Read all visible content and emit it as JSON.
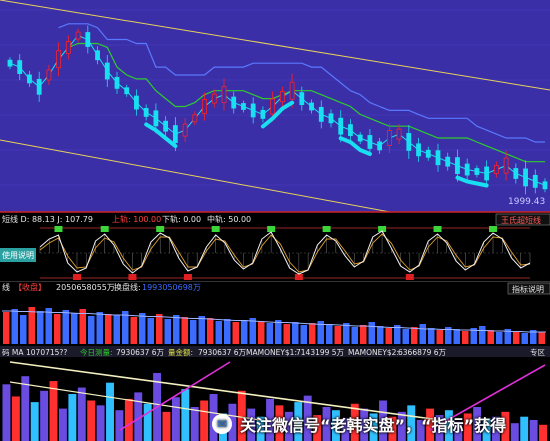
{
  "colors": {
    "panel1_bg": "#3b2fa8",
    "panel_bg": "#000000",
    "channel": "#e8d25a",
    "cyan": "#19e0f0",
    "red_candle": "#ff2020",
    "green_line": "#2dcc2d",
    "blue_line": "#5a78ff",
    "magenta": "#e030d8",
    "volume_blue": "#3b6cff",
    "white_line": "#f2f2f2"
  },
  "panel1": {
    "price_label": "1999.43",
    "chart_data": {
      "type": "line",
      "x": [
        0,
        1,
        2,
        3,
        4,
        5,
        6,
        7,
        8,
        9,
        10,
        11,
        12,
        13,
        14,
        15,
        16,
        17,
        18,
        19,
        20,
        21,
        22,
        23,
        24,
        25,
        26,
        27,
        28,
        29,
        30,
        31,
        32,
        33,
        34,
        35,
        36,
        37,
        38,
        39,
        40,
        41,
        42,
        43,
        44,
        45,
        46,
        47,
        48,
        49,
        50,
        51,
        52,
        53,
        54,
        55
      ],
      "series": [
        {
          "color": "cyan-red",
          "values": [
            72,
            70,
            64,
            60,
            66,
            74,
            80,
            86,
            84,
            76,
            68,
            62,
            58,
            52,
            47,
            44,
            40,
            36,
            38,
            44,
            50,
            54,
            56,
            52,
            50,
            48,
            46,
            50,
            55,
            58,
            54,
            50,
            46,
            44,
            40,
            38,
            34,
            32,
            30,
            34,
            36,
            32,
            28,
            26,
            24,
            22,
            20,
            18,
            17,
            16,
            18,
            20,
            16,
            14,
            12,
            10
          ]
        },
        {
          "color": "green",
          "values": [
            null,
            null,
            null,
            null,
            null,
            null,
            80,
            82,
            82,
            82,
            80,
            70,
            66,
            64,
            64,
            58,
            54,
            50,
            50,
            52,
            56,
            58,
            58,
            58,
            58,
            56,
            54,
            54,
            56,
            58,
            58,
            58,
            56,
            54,
            52,
            50,
            46,
            44,
            42,
            40,
            40,
            40,
            38,
            36,
            34,
            34,
            34,
            34,
            32,
            30,
            28,
            26,
            24,
            22,
            22,
            22
          ]
        },
        {
          "color": "blue",
          "values": [
            null,
            null,
            null,
            null,
            null,
            90,
            92,
            92,
            92,
            90,
            84,
            84,
            84,
            82,
            82,
            70,
            70,
            66,
            66,
            66,
            66,
            70,
            70,
            70,
            70,
            72,
            72,
            72,
            72,
            72,
            72,
            70,
            70,
            66,
            62,
            58,
            56,
            52,
            50,
            48,
            48,
            48,
            46,
            44,
            44,
            44,
            44,
            44,
            40,
            38,
            36,
            34,
            34,
            34,
            32,
            32
          ]
        }
      ],
      "ylim": [
        0,
        100
      ]
    }
  },
  "panel2": {
    "title_left": "短线 D: 88.13 J: 107.79",
    "upper_label": "上轨: 100.00",
    "lower_label": "下轨: 0.00",
    "mid_label": "中轨: 50.00",
    "right_tag": "王氏超短线",
    "side_button": "使用说明",
    "chart_data": {
      "type": "line",
      "series": [
        {
          "color": "white",
          "values": [
            62,
            78,
            86,
            30,
            12,
            20,
            74,
            88,
            66,
            28,
            10,
            24,
            72,
            90,
            80,
            40,
            14,
            22,
            62,
            86,
            70,
            36,
            18,
            30,
            78,
            92,
            58,
            20,
            8,
            16,
            66,
            86,
            74,
            44,
            22,
            34,
            82,
            94,
            60,
            24,
            12,
            26,
            74,
            88,
            70,
            34,
            16,
            28,
            72,
            90,
            78,
            40,
            20,
            30
          ]
        },
        {
          "color": "orange",
          "values": [
            56,
            70,
            80,
            44,
            20,
            22,
            60,
            80,
            72,
            40,
            16,
            22,
            58,
            82,
            82,
            52,
            22,
            22,
            54,
            78,
            74,
            46,
            22,
            28,
            64,
            86,
            68,
            32,
            12,
            16,
            52,
            78,
            78,
            54,
            28,
            32,
            70,
            88,
            70,
            36,
            16,
            24,
            62,
            82,
            74,
            46,
            22,
            26,
            60,
            82,
            80,
            52,
            26,
            28
          ]
        }
      ],
      "ylim": [
        0,
        100
      ],
      "hlines": [
        100,
        50,
        0
      ]
    }
  },
  "panel3": {
    "title_left": "线",
    "label_collect": "【收盘】",
    "value1": "2050658055万",
    "label2": "换盘线:",
    "value2": "1993050698万",
    "right_tag": "指标说明",
    "chart_data": {
      "type": "bar",
      "values": [
        64,
        70,
        58,
        74,
        66,
        72,
        60,
        68,
        62,
        70,
        56,
        64,
        60,
        58,
        66,
        54,
        62,
        52,
        60,
        50,
        58,
        54,
        48,
        56,
        52,
        46,
        50,
        44,
        48,
        52,
        46,
        42,
        48,
        40,
        44,
        38,
        42,
        46,
        40,
        36,
        42,
        34,
        38,
        44,
        36,
        32,
        38,
        30,
        34,
        40,
        32,
        28,
        34,
        30,
        26,
        32,
        36,
        28,
        24,
        30,
        26,
        22,
        28,
        24
      ],
      "line": [
        66,
        66,
        65,
        65,
        64,
        64,
        63,
        63,
        62,
        61,
        61,
        60,
        59,
        58,
        58,
        57,
        56,
        55,
        55,
        54,
        53,
        52,
        51,
        51,
        50,
        49,
        48,
        47,
        47,
        46,
        45,
        44,
        43,
        43,
        42,
        41,
        40,
        39,
        39,
        38,
        37,
        36,
        36,
        35,
        34,
        33,
        33,
        32,
        31,
        30,
        30,
        29,
        29,
        28,
        28,
        27,
        27,
        26,
        26,
        25,
        25,
        24,
        24,
        24
      ],
      "ylim": [
        0,
        100
      ]
    }
  },
  "panel4": {
    "title_left": "码 MA",
    "val0": "1070715??",
    "label1": "今日测量:",
    "val1": "7930637 6万",
    "label2": "量金额:",
    "val2": "7930637 6万",
    "label3": "MAMONEY$1:",
    "val3": "7143199 5万",
    "label4": "MAMONEY$2:",
    "val4": "6366879 6万",
    "right_tag": "专区",
    "chart_data": {
      "type": "bar",
      "values": [
        70,
        55,
        80,
        48,
        62,
        74,
        40,
        58,
        66,
        50,
        44,
        72,
        38,
        52,
        60,
        46,
        84,
        36,
        54,
        64,
        42,
        50,
        58,
        34,
        46,
        62,
        40,
        30,
        52,
        44,
        36,
        48,
        56,
        32,
        42,
        38,
        28,
        46,
        40,
        34,
        50,
        30,
        36,
        44,
        26,
        40,
        32,
        38,
        24,
        34,
        42,
        28,
        30,
        36,
        22,
        30,
        26,
        20
      ],
      "ylim": [
        0,
        100
      ]
    }
  },
  "watermark": {
    "icon": "speech-bubble-icon",
    "text": "关注微信号“老韩实盘”，“指标”获得"
  }
}
